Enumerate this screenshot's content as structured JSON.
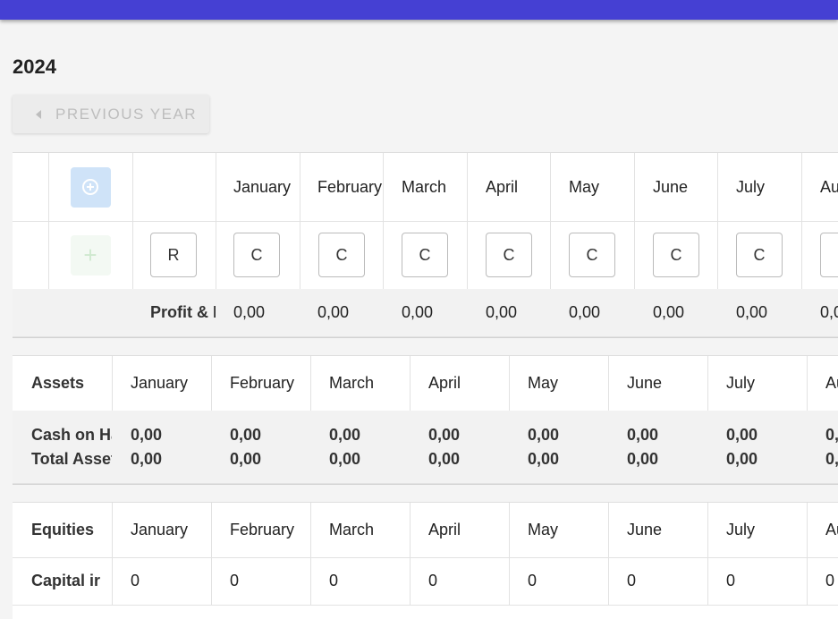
{
  "year": "2024",
  "prev_year_label": "PREVIOUS YEAR",
  "months": [
    "January",
    "February",
    "March",
    "April",
    "May",
    "June",
    "July",
    "Au"
  ],
  "pl": {
    "row_label_input": "R",
    "month_inputs": [
      "C",
      "C",
      "C",
      "C",
      "C",
      "C",
      "C",
      ""
    ],
    "summary_label": "Profit & L",
    "summary_values": [
      "0,00",
      "0,00",
      "0,00",
      "0,00",
      "0,00",
      "0,00",
      "0,00",
      "0,0"
    ]
  },
  "assets": {
    "header": "Assets",
    "row_labels": [
      "Cash on Ha",
      "Total Assets"
    ],
    "cash_values": [
      "0,00",
      "0,00",
      "0,00",
      "0,00",
      "0,00",
      "0,00",
      "0,00",
      "0,"
    ],
    "total_values": [
      "0,00",
      "0,00",
      "0,00",
      "0,00",
      "0,00",
      "0,00",
      "0,00",
      "0,"
    ]
  },
  "equities": {
    "header": "Equities",
    "row_label": "Capital ir",
    "values": [
      "0",
      "0",
      "0",
      "0",
      "0",
      "0",
      "0",
      "0"
    ]
  },
  "colors": {
    "topbar": "#4540d3",
    "add_button": "#cfe3f8"
  }
}
